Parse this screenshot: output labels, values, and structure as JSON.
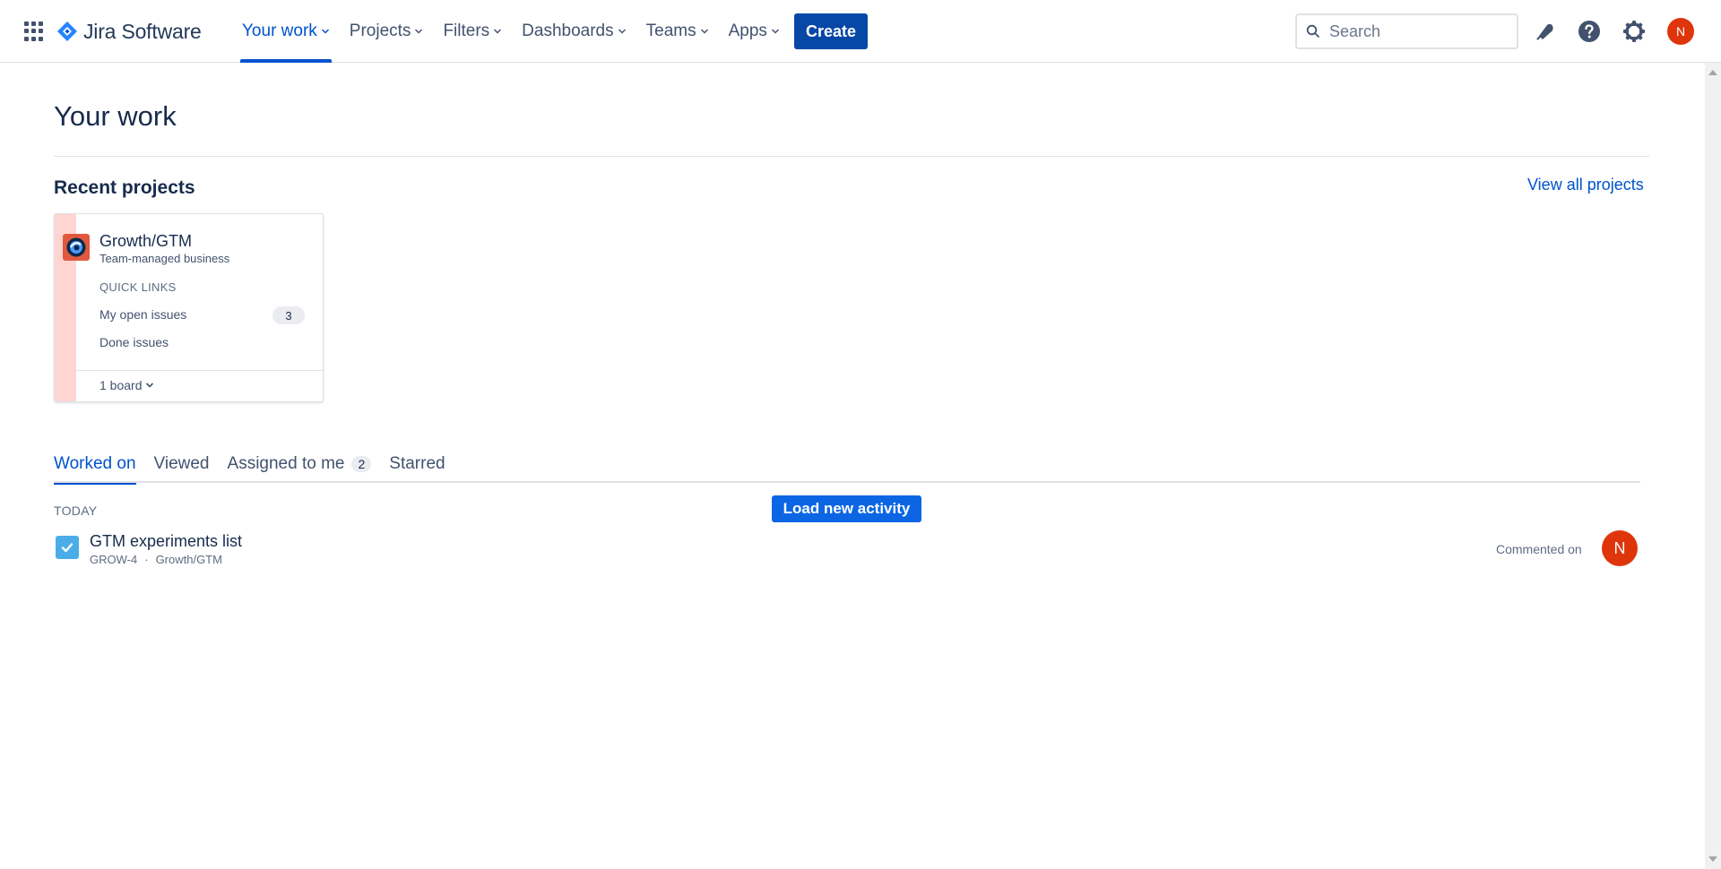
{
  "app": {
    "name": "Jira Software"
  },
  "nav": {
    "items": [
      {
        "label": "Your work"
      },
      {
        "label": "Projects"
      },
      {
        "label": "Filters"
      },
      {
        "label": "Dashboards"
      },
      {
        "label": "Teams"
      },
      {
        "label": "Apps"
      }
    ],
    "active": "Your work",
    "create_label": "Create"
  },
  "search": {
    "placeholder": "Search"
  },
  "user": {
    "initial": "N"
  },
  "colors": {
    "brand": "#0052cc",
    "create": "#0747a6",
    "avatar": "#de350b",
    "stripe": "#ffd5d2"
  },
  "page": {
    "title": "Your work"
  },
  "recent_projects": {
    "title": "Recent projects",
    "view_all": "View all projects",
    "cards": [
      {
        "name": "Growth/GTM",
        "type": "Team-managed business",
        "quick_links_title": "QUICK LINKS",
        "open_issues_label": "My open issues",
        "open_issues_count": "3",
        "done_issues_label": "Done issues",
        "boards_label": "1 board"
      }
    ]
  },
  "tabs": {
    "items": [
      {
        "label": "Worked on"
      },
      {
        "label": "Viewed"
      },
      {
        "label": "Assigned to me",
        "count": "2"
      },
      {
        "label": "Starred"
      }
    ],
    "active": "Worked on"
  },
  "activity": {
    "group_label": "TODAY",
    "load_button": "Load new activity",
    "items": [
      {
        "title": "GTM experiments list",
        "key": "GROW-4",
        "project": "Growth/GTM",
        "action": "Commented on",
        "user_initial": "N"
      }
    ]
  },
  "icons": [
    "app-switcher-icon",
    "jira-logo-icon",
    "chevron-down-icon",
    "search-icon",
    "notifications-icon",
    "help-icon",
    "settings-icon",
    "project-avatar-icon",
    "task-checkbox-icon"
  ]
}
